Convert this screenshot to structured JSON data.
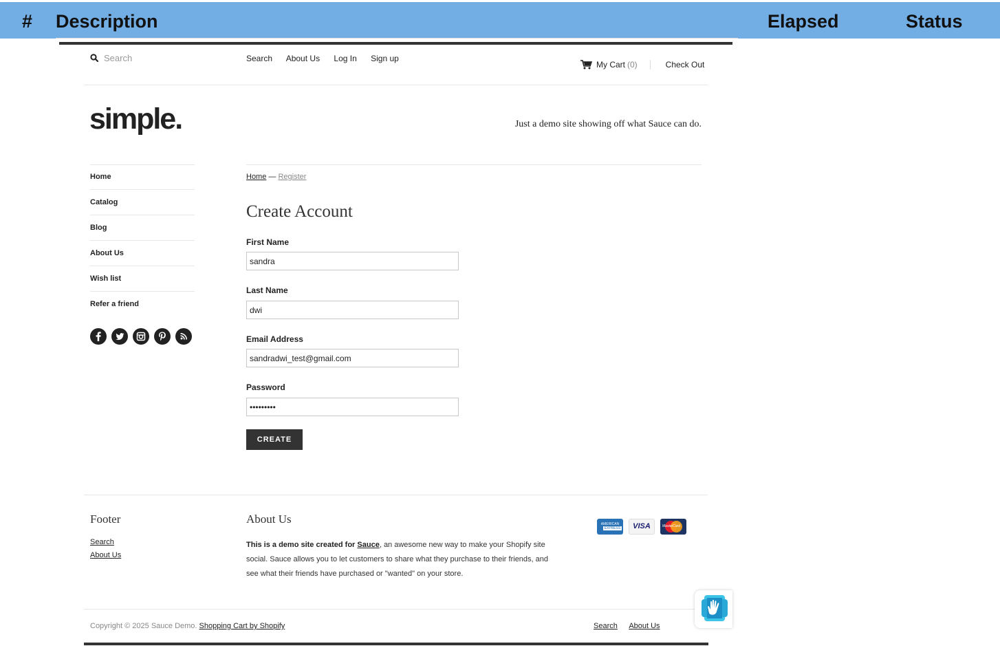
{
  "report_header": {
    "hash": "#",
    "description": "Description",
    "elapsed": "Elapsed",
    "status": "Status",
    "color": "#72ade4"
  },
  "top_bar": {
    "search_placeholder": "Search",
    "nav": [
      "Search",
      "About Us",
      "Log In",
      "Sign up"
    ],
    "cart_label": "My Cart",
    "cart_count": "(0)",
    "checkout": "Check Out"
  },
  "brand": {
    "logo": "simple.",
    "tagline": "Just a demo site showing off what Sauce can do."
  },
  "sidebar": {
    "items": [
      "Home",
      "Catalog",
      "Blog",
      "About Us",
      "Wish list",
      "Refer a friend"
    ],
    "social_icons": [
      "facebook-icon",
      "twitter-icon",
      "instagram-icon",
      "pinterest-icon",
      "rss-icon"
    ]
  },
  "breadcrumb": {
    "home": "Home",
    "separator": "—",
    "current": "Register"
  },
  "form": {
    "title": "Create Account",
    "first_name_label": "First Name",
    "first_name_value": "sandra",
    "last_name_label": "Last Name",
    "last_name_value": "dwi",
    "email_label": "Email Address",
    "email_value": "sandradwi_test@gmail.com",
    "password_label": "Password",
    "password_value": "sandradwi",
    "submit": "CREATE"
  },
  "footer": {
    "col1_title": "Footer",
    "col1_links": [
      "Search",
      "About Us"
    ],
    "col2_title": "About Us",
    "about_bold": "This is a demo site created for",
    "about_link": "Sauce",
    "about_rest": ", an awesome new way to make your Shopify site social. Sauce allows you to let customers to share what they purchase to their friends, and see what their friends have purchased or \"wanted\" on your store.",
    "cards": {
      "amex_line1": "AMERICAN",
      "amex_line2": "EXPRESS",
      "visa": "VISA",
      "mastercard": "MasterCard"
    },
    "copyright": "Copyright © 2025 Sauce Demo.",
    "shopify_link": "Shopping Cart by Shopify",
    "bottom_links": [
      "Search",
      "About Us"
    ]
  }
}
